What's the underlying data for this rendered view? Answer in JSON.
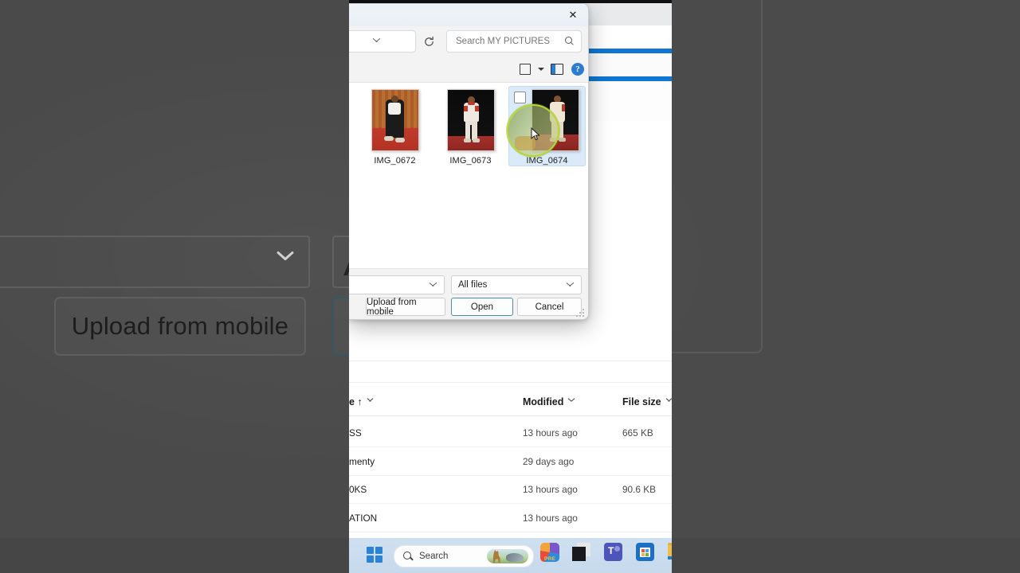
{
  "dialog": {
    "close_label": "✕",
    "search": {
      "placeholder": "Search MY PICTURES",
      "value": ""
    },
    "toolbar": {
      "view_icon": "view-square-icon",
      "view_caret_icon": "chevron-down-icon",
      "preview_pane_icon": "preview-pane-icon",
      "help_label": "?"
    },
    "files": [
      {
        "name": "IMG_0672",
        "selected": false
      },
      {
        "name": "IMG_0673",
        "selected": false
      },
      {
        "name": "IMG_0674",
        "selected": true
      }
    ],
    "filename_field": {
      "value": "",
      "placeholder": ""
    },
    "filetype_filter": {
      "value": "All files"
    },
    "buttons": {
      "upload": "Upload from mobile",
      "open": "Open",
      "cancel": "Cancel"
    }
  },
  "background": {
    "file_list": {
      "columns": [
        "e ↑",
        "Modified",
        "File size"
      ],
      "rows": [
        {
          "name": "SS",
          "modified": "13 hours ago",
          "size": "665 KB"
        },
        {
          "name": "menty",
          "modified": "29 days ago",
          "size": ""
        },
        {
          "name": "0KS",
          "modified": "13 hours ago",
          "size": "90.6 KB"
        },
        {
          "name": "ATION",
          "modified": "13 hours ago",
          "size": ""
        }
      ]
    }
  },
  "taskbar": {
    "start_label": "start-icon",
    "search_placeholder": "Search",
    "apps": [
      "copilot-pre-icon",
      "dark-app-icon",
      "teams-icon",
      "store-icon",
      "file-explorer-icon"
    ]
  },
  "magnified": {
    "upload_label": "Upload from mobile",
    "filter_initial": "A"
  },
  "colors": {
    "accent": "#2b7cd3",
    "selection": "#dbeaf8",
    "lens": "#b8d831",
    "focus_ring": "#4b8fa6"
  }
}
